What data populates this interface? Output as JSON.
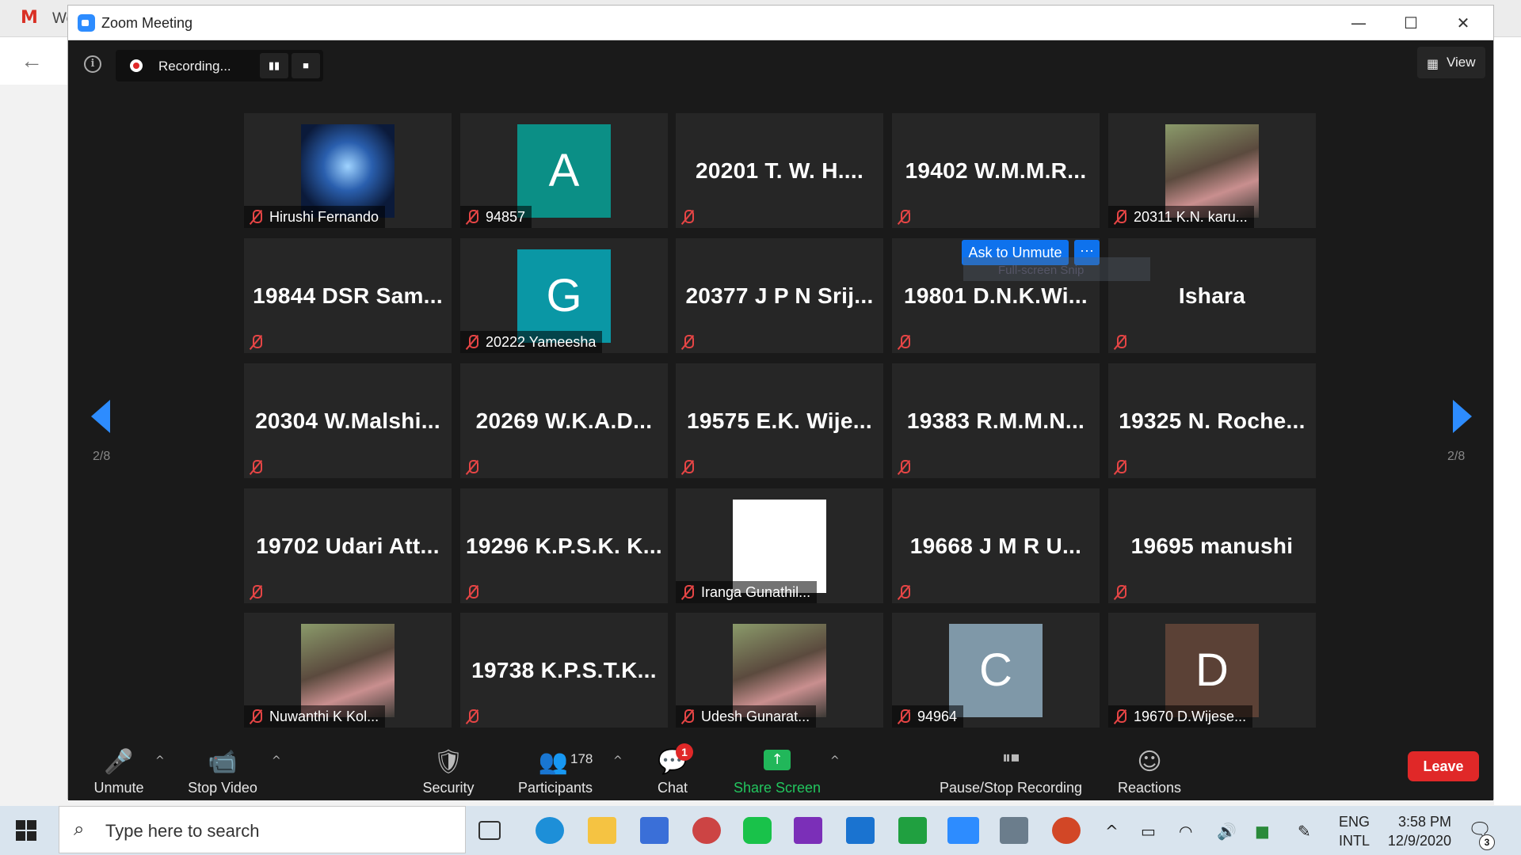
{
  "background": {
    "tab_letter": "M",
    "tab_fragment": "We"
  },
  "window": {
    "title": "Zoom Meeting",
    "minimize": "—",
    "maximize": "☐",
    "close": "✕"
  },
  "recording": {
    "status": "Recording...",
    "pause_icon": "pause-icon",
    "stop_icon": "stop-icon"
  },
  "view": {
    "label": "View",
    "icon": "grid-icon"
  },
  "pager": {
    "left": "2/8",
    "right": "2/8"
  },
  "colors": {
    "accent": "#2d8cff",
    "muted": "#e64545",
    "leave": "#e02828",
    "tile": "#262626"
  },
  "participants": [
    {
      "label": "Hirushi Fernando",
      "image": "letter-s-logo"
    },
    {
      "label": "94857",
      "avatar": "A",
      "color": "#0b8f86"
    },
    {
      "name": "20201  T. W. H...."
    },
    {
      "name": "19402  W.M.M.R..."
    },
    {
      "label": "20311 K.N. karu...",
      "image": "photo"
    },
    {
      "name": "19844  DSR  Sam..."
    },
    {
      "label": "20222 Yameesha",
      "avatar": "G",
      "color": "#0a97a5"
    },
    {
      "name": "20377  J  P  N  Srij..."
    },
    {
      "name": "19801  D.N.K.Wi..."
    },
    {
      "name": "Ishara"
    },
    {
      "name": "20304  W.Malshi..."
    },
    {
      "name": "20269  W.K.A.D..."
    },
    {
      "name": "19575  E.K.  Wije..."
    },
    {
      "name": "19383  R.M.M.N..."
    },
    {
      "name": "19325  N.  Roche..."
    },
    {
      "name": "19702  Udari  Att..."
    },
    {
      "name": "19296  K.P.S.K.  K..."
    },
    {
      "label": "Iranga Gunathil...",
      "image": "blank"
    },
    {
      "name": "19668  J  M  R  U..."
    },
    {
      "name": "19695  manushi"
    },
    {
      "label": "Nuwanthi K Kol...",
      "image": "photo"
    },
    {
      "name": "19738   K.P.S.T.K..."
    },
    {
      "label": "Udesh Gunarat...",
      "image": "photo"
    },
    {
      "label": "94964",
      "avatar": "C",
      "color": "#7f98a8"
    },
    {
      "label": "19670 D.Wijese...",
      "avatar": "D",
      "color": "#5b4136"
    }
  ],
  "hover": {
    "ask_to_unmute": "Ask to Unmute",
    "more": "···",
    "ghost_text": "Full-screen Snip"
  },
  "toolbar": {
    "unmute": "Unmute",
    "stop_video": "Stop Video",
    "security": "Security",
    "participants": "Participants",
    "participant_count": "178",
    "chat": "Chat",
    "chat_badge": "1",
    "share_screen": "Share Screen",
    "pause_stop_recording": "Pause/Stop Recording",
    "reactions": "Reactions",
    "leave": "Leave"
  },
  "taskbar": {
    "search_placeholder": "Type here to search",
    "lang_top": "ENG",
    "lang_bottom": "INTL",
    "time": "3:58 PM",
    "date": "12/9/2020",
    "notification_count": "3"
  }
}
